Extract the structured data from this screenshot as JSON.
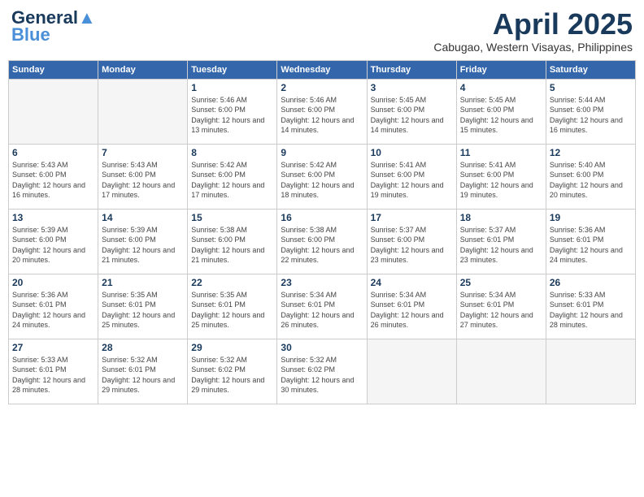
{
  "header": {
    "logo_line1": "General",
    "logo_line2": "Blue",
    "month_year": "April 2025",
    "location": "Cabugao, Western Visayas, Philippines"
  },
  "weekdays": [
    "Sunday",
    "Monday",
    "Tuesday",
    "Wednesday",
    "Thursday",
    "Friday",
    "Saturday"
  ],
  "weeks": [
    [
      {
        "day": "",
        "empty": true
      },
      {
        "day": "",
        "empty": true
      },
      {
        "day": "1",
        "sunrise": "5:46 AM",
        "sunset": "6:00 PM",
        "daylight": "12 hours and 13 minutes."
      },
      {
        "day": "2",
        "sunrise": "5:46 AM",
        "sunset": "6:00 PM",
        "daylight": "12 hours and 14 minutes."
      },
      {
        "day": "3",
        "sunrise": "5:45 AM",
        "sunset": "6:00 PM",
        "daylight": "12 hours and 14 minutes."
      },
      {
        "day": "4",
        "sunrise": "5:45 AM",
        "sunset": "6:00 PM",
        "daylight": "12 hours and 15 minutes."
      },
      {
        "day": "5",
        "sunrise": "5:44 AM",
        "sunset": "6:00 PM",
        "daylight": "12 hours and 16 minutes."
      }
    ],
    [
      {
        "day": "6",
        "sunrise": "5:43 AM",
        "sunset": "6:00 PM",
        "daylight": "12 hours and 16 minutes."
      },
      {
        "day": "7",
        "sunrise": "5:43 AM",
        "sunset": "6:00 PM",
        "daylight": "12 hours and 17 minutes."
      },
      {
        "day": "8",
        "sunrise": "5:42 AM",
        "sunset": "6:00 PM",
        "daylight": "12 hours and 17 minutes."
      },
      {
        "day": "9",
        "sunrise": "5:42 AM",
        "sunset": "6:00 PM",
        "daylight": "12 hours and 18 minutes."
      },
      {
        "day": "10",
        "sunrise": "5:41 AM",
        "sunset": "6:00 PM",
        "daylight": "12 hours and 19 minutes."
      },
      {
        "day": "11",
        "sunrise": "5:41 AM",
        "sunset": "6:00 PM",
        "daylight": "12 hours and 19 minutes."
      },
      {
        "day": "12",
        "sunrise": "5:40 AM",
        "sunset": "6:00 PM",
        "daylight": "12 hours and 20 minutes."
      }
    ],
    [
      {
        "day": "13",
        "sunrise": "5:39 AM",
        "sunset": "6:00 PM",
        "daylight": "12 hours and 20 minutes."
      },
      {
        "day": "14",
        "sunrise": "5:39 AM",
        "sunset": "6:00 PM",
        "daylight": "12 hours and 21 minutes."
      },
      {
        "day": "15",
        "sunrise": "5:38 AM",
        "sunset": "6:00 PM",
        "daylight": "12 hours and 21 minutes."
      },
      {
        "day": "16",
        "sunrise": "5:38 AM",
        "sunset": "6:00 PM",
        "daylight": "12 hours and 22 minutes."
      },
      {
        "day": "17",
        "sunrise": "5:37 AM",
        "sunset": "6:00 PM",
        "daylight": "12 hours and 23 minutes."
      },
      {
        "day": "18",
        "sunrise": "5:37 AM",
        "sunset": "6:01 PM",
        "daylight": "12 hours and 23 minutes."
      },
      {
        "day": "19",
        "sunrise": "5:36 AM",
        "sunset": "6:01 PM",
        "daylight": "12 hours and 24 minutes."
      }
    ],
    [
      {
        "day": "20",
        "sunrise": "5:36 AM",
        "sunset": "6:01 PM",
        "daylight": "12 hours and 24 minutes."
      },
      {
        "day": "21",
        "sunrise": "5:35 AM",
        "sunset": "6:01 PM",
        "daylight": "12 hours and 25 minutes."
      },
      {
        "day": "22",
        "sunrise": "5:35 AM",
        "sunset": "6:01 PM",
        "daylight": "12 hours and 25 minutes."
      },
      {
        "day": "23",
        "sunrise": "5:34 AM",
        "sunset": "6:01 PM",
        "daylight": "12 hours and 26 minutes."
      },
      {
        "day": "24",
        "sunrise": "5:34 AM",
        "sunset": "6:01 PM",
        "daylight": "12 hours and 26 minutes."
      },
      {
        "day": "25",
        "sunrise": "5:34 AM",
        "sunset": "6:01 PM",
        "daylight": "12 hours and 27 minutes."
      },
      {
        "day": "26",
        "sunrise": "5:33 AM",
        "sunset": "6:01 PM",
        "daylight": "12 hours and 28 minutes."
      }
    ],
    [
      {
        "day": "27",
        "sunrise": "5:33 AM",
        "sunset": "6:01 PM",
        "daylight": "12 hours and 28 minutes."
      },
      {
        "day": "28",
        "sunrise": "5:32 AM",
        "sunset": "6:01 PM",
        "daylight": "12 hours and 29 minutes."
      },
      {
        "day": "29",
        "sunrise": "5:32 AM",
        "sunset": "6:02 PM",
        "daylight": "12 hours and 29 minutes."
      },
      {
        "day": "30",
        "sunrise": "5:32 AM",
        "sunset": "6:02 PM",
        "daylight": "12 hours and 30 minutes."
      },
      {
        "day": "",
        "empty": true
      },
      {
        "day": "",
        "empty": true
      },
      {
        "day": "",
        "empty": true
      }
    ]
  ]
}
